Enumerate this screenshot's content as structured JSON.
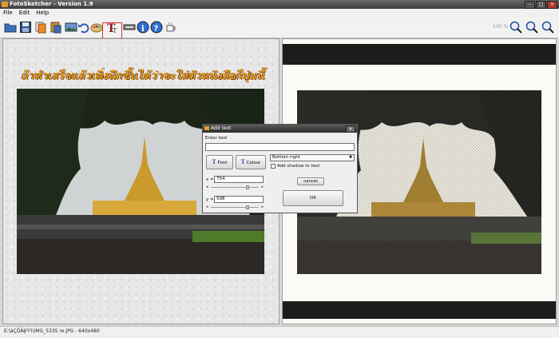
{
  "window": {
    "title": "FotoSketcher - Version 1.9"
  },
  "menu": {
    "items": [
      "File",
      "Edit",
      "Help"
    ]
  },
  "toolbar": {
    "icons": [
      "open-folder-icon",
      "save-icon",
      "copy-icon",
      "paste-icon",
      "edit-image-icon",
      "undo-icon",
      "palette-icon",
      "text-icon",
      "frame-icon",
      "info-icon",
      "help-icon",
      "coffee-icon"
    ],
    "zoom_label": "100 %",
    "zoom_icons": [
      "zoom-out-icon",
      "zoom-fit-icon",
      "zoom-in-icon"
    ]
  },
  "caption": "ถ้าทำเสร็จแล้วเพิ่งนึกขึ้นได้ว่าจะใส่ตัวหนังสือก็ปุ่มนี้",
  "dialog": {
    "title": "Add text",
    "enter_text_label": "Enter text",
    "text_value": "",
    "font_button": "Font",
    "colour_button": "Colour",
    "position_value": "Bottom right",
    "shadow_label": "Add shadow to text",
    "shadow_checked": false,
    "x_label": "x =",
    "x_value": "754",
    "y_label": "y =",
    "y_value": "598",
    "cancel_button": "cancel",
    "ok_button": "OK"
  },
  "status": {
    "text": "E:\\àÇÕÂ§¹ì¹ì\\IMG_5335 re.JPG - 640x480"
  }
}
